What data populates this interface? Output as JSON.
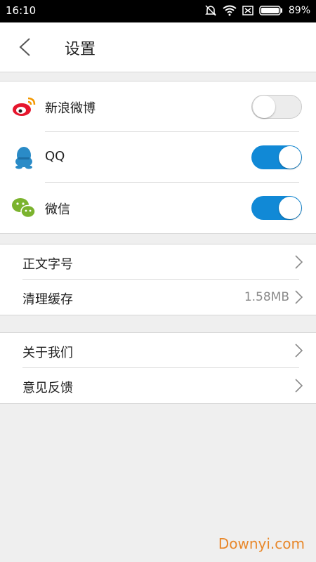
{
  "status": {
    "time": "16:10",
    "battery": "89%"
  },
  "header": {
    "title": "设置"
  },
  "social": [
    {
      "label": "新浪微博",
      "icon": "weibo-icon",
      "enabled": false
    },
    {
      "label": "QQ",
      "icon": "qq-icon",
      "enabled": true
    },
    {
      "label": "微信",
      "icon": "wechat-icon",
      "enabled": true
    }
  ],
  "settings": [
    {
      "label": "正文字号",
      "value": ""
    },
    {
      "label": "清理缓存",
      "value": "1.58MB"
    }
  ],
  "about": [
    {
      "label": "关于我们"
    },
    {
      "label": "意见反馈"
    }
  ],
  "watermark": "Downyi.com",
  "colors": {
    "accent": "#1189d6",
    "weibo": "#e6162d",
    "qq": "#2a8bc7",
    "wechat": "#7bb32e"
  }
}
